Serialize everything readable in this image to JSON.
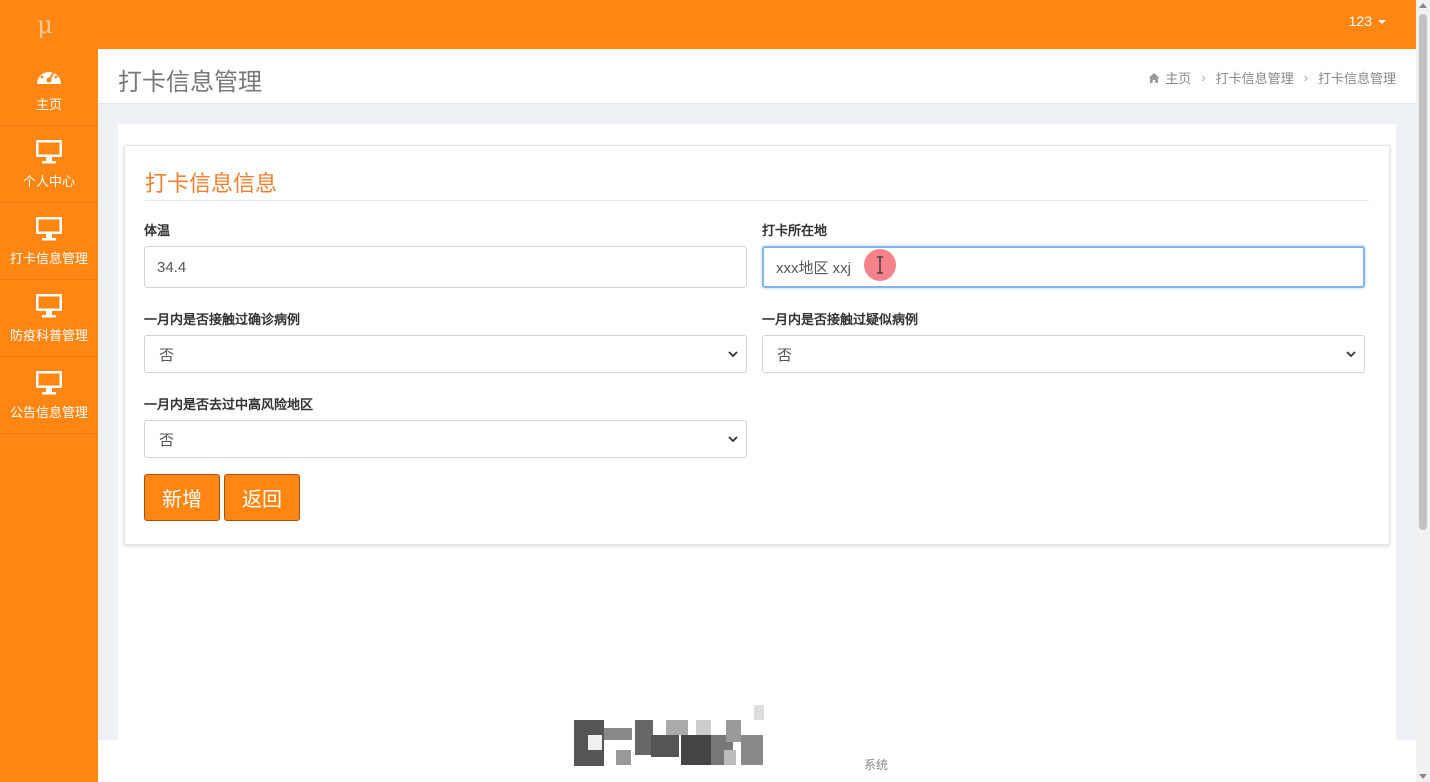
{
  "header": {
    "logo_glyph": "μ",
    "user_label": "123"
  },
  "sidebar": {
    "items": [
      {
        "label": "主页",
        "icon": "dashboard-icon"
      },
      {
        "label": "个人中心",
        "icon": "monitor-icon"
      },
      {
        "label": "打卡信息管理",
        "icon": "monitor-icon"
      },
      {
        "label": "防疫科普管理",
        "icon": "monitor-icon"
      },
      {
        "label": "公告信息管理",
        "icon": "monitor-icon"
      }
    ]
  },
  "page": {
    "title": "打卡信息管理",
    "breadcrumb": [
      "主页",
      "打卡信息管理",
      "打卡信息管理"
    ],
    "breadcrumb_sep": "›"
  },
  "form": {
    "title": "打卡信息信息",
    "fields": {
      "temperature": {
        "label": "体温",
        "value": "34.4"
      },
      "location": {
        "label": "打卡所在地",
        "value": "xxx地区 xxj"
      },
      "confirmed_contact": {
        "label": "一月内是否接触过确诊病例",
        "selected": "否"
      },
      "suspected_contact": {
        "label": "一月内是否接触过疑似病例",
        "selected": "否"
      },
      "risk_area": {
        "label": "一月内是否去过中高风险地区",
        "selected": "否"
      }
    },
    "buttons": {
      "add": "新增",
      "back": "返回"
    }
  },
  "footer": {
    "text": "系统"
  },
  "colors": {
    "accent": "#ff8613",
    "title": "#f08030",
    "focus_border": "#7fb5e8"
  }
}
